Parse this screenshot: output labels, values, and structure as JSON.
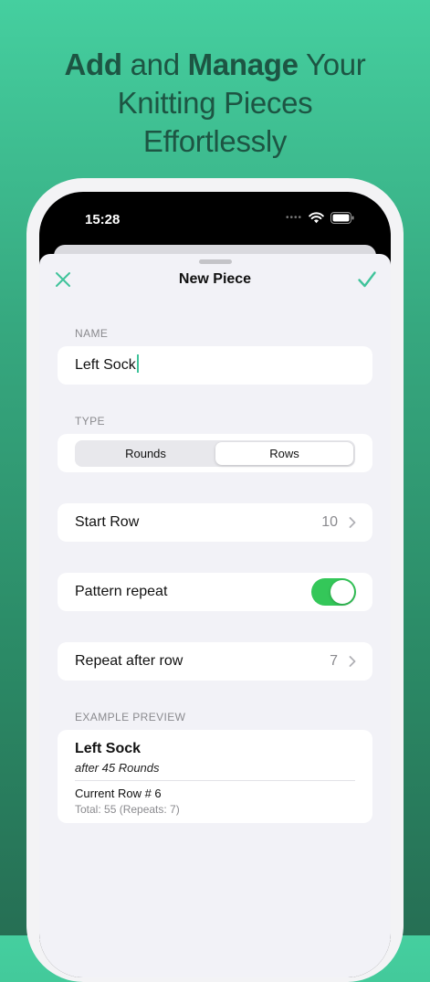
{
  "headline": {
    "word_add": "Add",
    "word_and": " and ",
    "word_manage": "Manage",
    "word_your": " Your",
    "line2": "Knitting Pieces",
    "line3": "Effortlessly"
  },
  "status_bar": {
    "time": "15:28",
    "icons": [
      "signal-dots-icon",
      "wifi-icon",
      "battery-icon"
    ]
  },
  "nav": {
    "title": "New Piece",
    "close_icon": "close-icon",
    "done_icon": "checkmark-icon"
  },
  "form": {
    "name_label": "NAME",
    "name_value": "Left Sock",
    "type_label": "TYPE",
    "type_options": [
      "Rounds",
      "Rows"
    ],
    "type_selected": "Rows",
    "start_row_label": "Start Row",
    "start_row_value": "10",
    "pattern_repeat_label": "Pattern repeat",
    "pattern_repeat_on": true,
    "repeat_after_label": "Repeat after row",
    "repeat_after_value": "7"
  },
  "preview": {
    "label": "EXAMPLE PREVIEW",
    "title": "Left Sock",
    "subtitle": "after 45 Rounds",
    "current_row": "Current Row # 6",
    "total": "Total: 55 (Repeats: 7)"
  },
  "colors": {
    "accent": "#3fc39a",
    "toggle_on": "#34c759",
    "headline_text": "#1d5543"
  }
}
